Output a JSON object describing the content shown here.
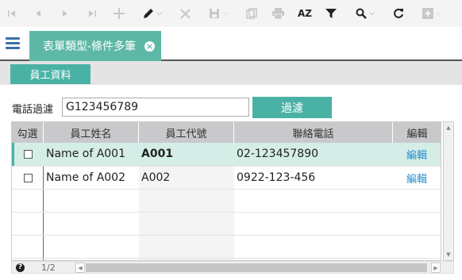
{
  "toolbar": {
    "icons": [
      "first-icon",
      "prev-icon",
      "next-icon",
      "last-icon",
      "add-icon",
      "edit-icon",
      "delete-icon",
      "save-icon",
      "copy-icon",
      "print-icon",
      "sort-icon",
      "filter-icon",
      "search-icon",
      "refresh-icon",
      "export-icon"
    ],
    "sort_label": "AZ"
  },
  "tab": {
    "label": "表單類型-條件多筆",
    "close": "×"
  },
  "subtab": {
    "label": "員工資料"
  },
  "filter": {
    "label": "電話過濾",
    "value": "G123456789",
    "button": "過濾"
  },
  "grid": {
    "headers": [
      "勾選",
      "員工姓名",
      "員工代號",
      "聯絡電話",
      "編輯"
    ],
    "rows": [
      {
        "name": "Name of A001",
        "id": "A001",
        "phone": "02-123457890",
        "edit": "編輯",
        "selected": true
      },
      {
        "name": "Name of A002",
        "id": "A002",
        "phone": "0922-123-456",
        "edit": "編輯",
        "selected": false
      }
    ]
  },
  "pager": {
    "text": "1/2",
    "help": "?"
  },
  "colors": {
    "accent": "#4ab2a5",
    "selected_row": "#d4ede7",
    "link": "#2a8fd0"
  }
}
